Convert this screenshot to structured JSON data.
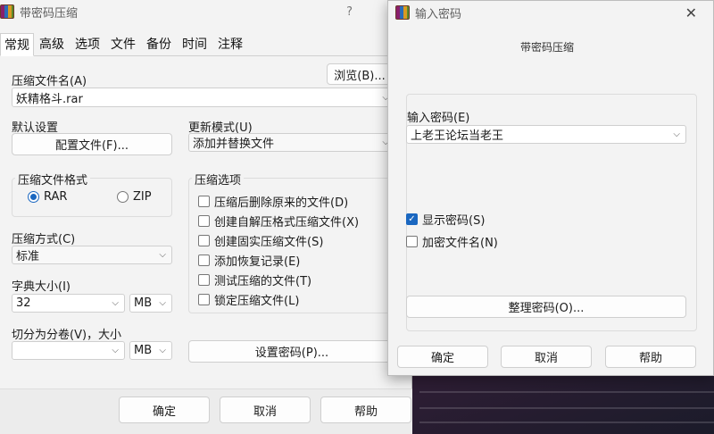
{
  "main": {
    "title": "带密码压缩",
    "help": "?",
    "tabs": [
      "常规",
      "高级",
      "选项",
      "文件",
      "备份",
      "时间",
      "注释"
    ],
    "archive_name_label": "压缩文件名(A)",
    "browse_button": "浏览(B)...",
    "archive_name_value": "妖精格斗.rar",
    "default_settings_label": "默认设置",
    "profiles_button": "配置文件(F)...",
    "update_mode_label": "更新模式(U)",
    "update_mode_value": "添加并替换文件",
    "format_group": "压缩文件格式",
    "format_rar": "RAR",
    "format_zip": "ZIP",
    "options_group": "压缩选项",
    "options": [
      "压缩后删除原来的文件(D)",
      "创建自解压格式压缩文件(X)",
      "创建固实压缩文件(S)",
      "添加恢复记录(E)",
      "测试压缩的文件(T)",
      "锁定压缩文件(L)"
    ],
    "method_label": "压缩方式(C)",
    "method_value": "标准",
    "dict_label": "字典大小(I)",
    "dict_value": "32",
    "dict_unit": "MB",
    "split_label": "切分为分卷(V)，大小",
    "split_value": "",
    "split_unit": "MB",
    "set_password_button": "设置密码(P)...",
    "ok_button": "确定",
    "cancel_button": "取消",
    "help_button": "帮助"
  },
  "password_dialog": {
    "title": "输入密码",
    "subtitle": "带密码压缩",
    "enter_password_label": "输入密码(E)",
    "password_value": "上老王论坛当老王",
    "show_password_label": "显示密码(S)",
    "show_password_checked": true,
    "encrypt_names_label": "加密文件名(N)",
    "encrypt_names_checked": false,
    "organize_button": "整理密码(O)...",
    "ok_button": "确定",
    "cancel_button": "取消",
    "help_button": "帮助"
  }
}
